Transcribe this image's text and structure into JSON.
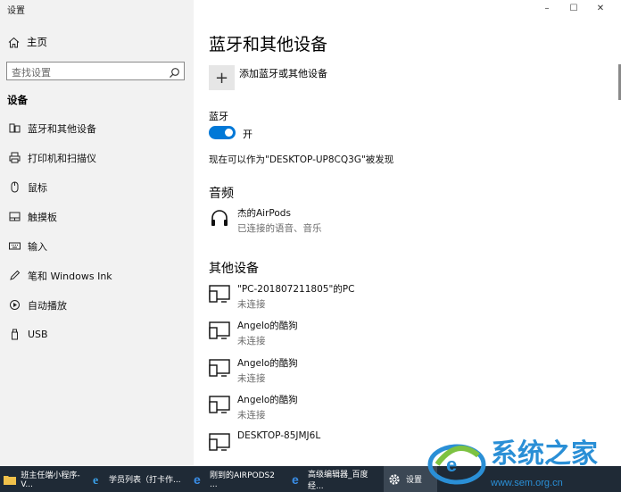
{
  "window": {
    "app_title": "设置",
    "controls": [
      "–",
      "☐",
      "✕"
    ]
  },
  "sidebar": {
    "home_label": "主页",
    "search_placeholder": "查找设置",
    "section_title": "设备",
    "items": [
      {
        "label": "蓝牙和其他设备",
        "icon": "bluetooth-devices-icon"
      },
      {
        "label": "打印机和扫描仪",
        "icon": "printer-icon"
      },
      {
        "label": "鼠标",
        "icon": "mouse-icon"
      },
      {
        "label": "触摸板",
        "icon": "touchpad-icon"
      },
      {
        "label": "输入",
        "icon": "keyboard-icon"
      },
      {
        "label": "笔和 Windows Ink",
        "icon": "pen-icon"
      },
      {
        "label": "自动播放",
        "icon": "autoplay-icon"
      },
      {
        "label": "USB",
        "icon": "usb-icon"
      }
    ]
  },
  "main": {
    "title": "蓝牙和其他设备",
    "add_button_symbol": "+",
    "add_label": "添加蓝牙或其他设备",
    "bluetooth_label": "蓝牙",
    "toggle_state": "开",
    "discoverable_text": "现在可以作为\"DESKTOP-UP8CQ3G\"被发现",
    "audio_heading": "音频",
    "audio_devices": [
      {
        "name": "杰的AirPods",
        "status": "已连接的语音、音乐",
        "icon": "headphones-icon"
      }
    ],
    "other_heading": "其他设备",
    "other_devices": [
      {
        "name": "\"PC-201807211805\"的PC",
        "status": "未连接",
        "icon": "display-device-icon"
      },
      {
        "name": "Angelo的酷狗",
        "status": "未连接",
        "icon": "display-device-icon"
      },
      {
        "name": "Angelo的酷狗",
        "status": "未连接",
        "icon": "display-device-icon"
      },
      {
        "name": "Angelo的酷狗",
        "status": "未连接",
        "icon": "display-device-icon"
      },
      {
        "name": "DESKTOP-85JMJ6L",
        "status": "",
        "icon": "display-device-icon"
      }
    ]
  },
  "taskbar": {
    "items": [
      {
        "label": "班主任端小程序-V...",
        "icon": "folder-icon"
      },
      {
        "label": "学员列表（打卡作...",
        "icon": "ie-icon"
      },
      {
        "label": "刚到的AIRPODS2 ...",
        "icon": "edge-icon"
      },
      {
        "label": "高级编辑器_百度经...",
        "icon": "edge-icon"
      },
      {
        "label": "设置",
        "icon": "gear-icon"
      }
    ]
  },
  "watermark": {
    "text": "系统之家",
    "url": "www.sem.org.cn"
  },
  "colors": {
    "accent": "#0078d7",
    "sidebar_bg": "#f2f2f2",
    "taskbar_bg": "#1f2a36"
  }
}
